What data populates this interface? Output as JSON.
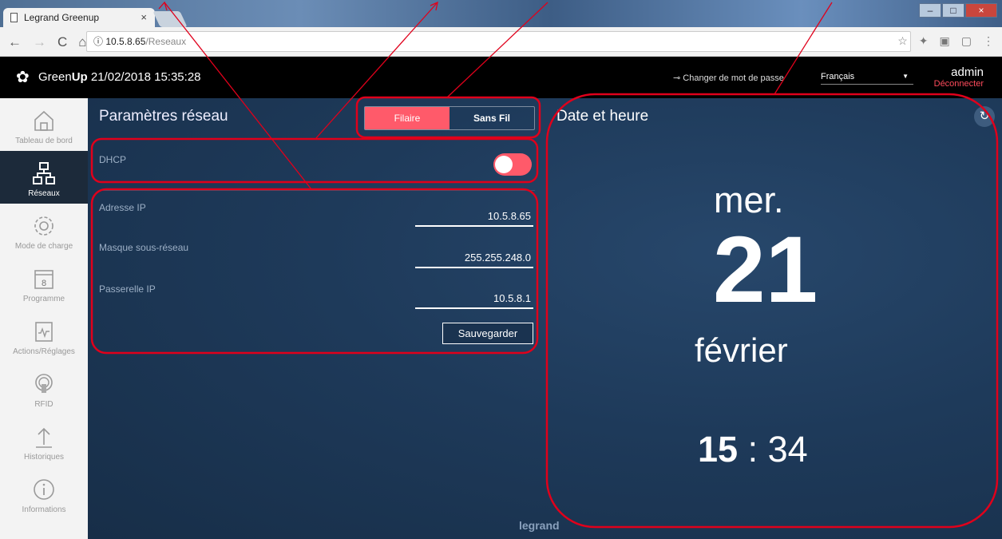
{
  "browser": {
    "tab_title": "Legrand Greenup",
    "tab_close": "×",
    "url_host": "10.5.8.65",
    "url_path": "/Reseaux",
    "info_glyph": "ⓘ"
  },
  "header": {
    "brand_prefix": "Green",
    "brand_bold": "Up",
    "datetime": "21/02/2018 15:35:28",
    "change_password": "Changer de mot de passe",
    "language": "Français",
    "user": "admin",
    "logout": "Déconnecter"
  },
  "sidebar": {
    "items": [
      {
        "label": "Tableau de bord",
        "icon": "home-icon"
      },
      {
        "label": "Réseaux",
        "icon": "network-icon",
        "active": true
      },
      {
        "label": "Mode de charge",
        "icon": "gear-icon"
      },
      {
        "label": "Programme",
        "icon": "calendar-icon",
        "badge": "8"
      },
      {
        "label": "Actions/Réglages",
        "icon": "monitor-icon"
      },
      {
        "label": "RFID",
        "icon": "rfid-icon"
      },
      {
        "label": "Historiques",
        "icon": "upload-icon"
      },
      {
        "label": "Informations",
        "icon": "info-icon"
      }
    ]
  },
  "network": {
    "title": "Paramètres réseau",
    "tab_wired": "Filaire",
    "tab_wireless": "Sans Fil",
    "dhcp_label": "DHCP",
    "dhcp_enabled": true,
    "ip_label": "Adresse IP",
    "ip_value": "10.5.8.65",
    "mask_label": "Masque sous-réseau",
    "mask_value": "255.255.248.0",
    "gateway_label": "Passerelle IP",
    "gateway_value": "10.5.8.1",
    "save": "Sauvegarder"
  },
  "datetime_panel": {
    "title": "Date et heure",
    "day_name": "mer.",
    "day_number": "21",
    "month": "février",
    "hour": "15",
    "separator": ":",
    "minute": "34"
  },
  "footer": {
    "logo": "legrand"
  },
  "colors": {
    "accent": "#ff5a6a",
    "annotation": "#e0001b",
    "panel": "#1e3a5a"
  }
}
